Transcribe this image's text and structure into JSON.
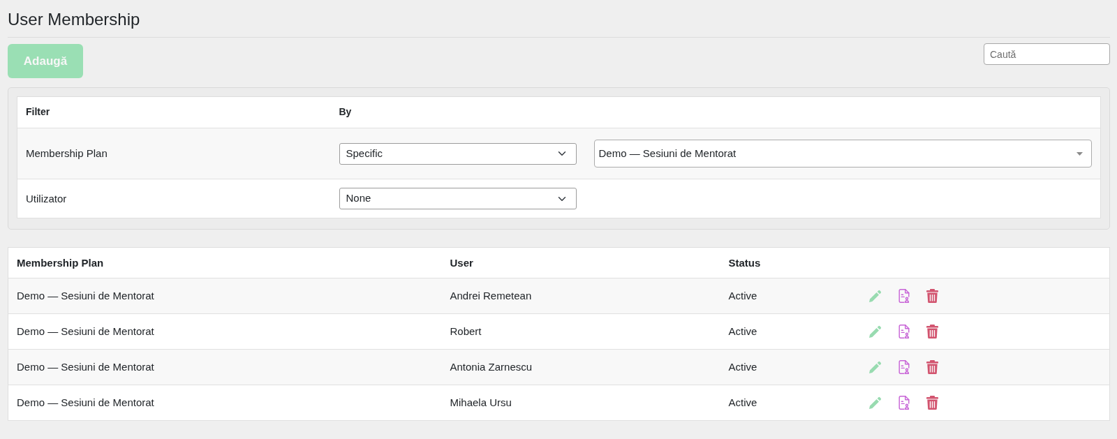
{
  "page": {
    "title": "User Membership"
  },
  "toolbar": {
    "add_button": {
      "label": "Adaugă",
      "disabled": true
    },
    "search": {
      "placeholder": "Caută"
    }
  },
  "filter": {
    "columns": [
      "Filter",
      "By"
    ],
    "rows": [
      {
        "label": "Membership Plan",
        "mode": "Specific",
        "value": "Demo — Sesiuni de Mentorat"
      },
      {
        "label": "Utilizator",
        "mode": "None"
      }
    ]
  },
  "table": {
    "columns": [
      "Membership Plan",
      "User",
      "Status"
    ],
    "rows": [
      {
        "cells": [
          "Demo — Sesiuni de Mentorat",
          "Andrei Remetean",
          "Active"
        ]
      },
      {
        "cells": [
          "Demo — Sesiuni de Mentorat",
          "Robert",
          "Active"
        ]
      },
      {
        "cells": [
          "Demo — Sesiuni de Mentorat",
          "Antonia Zarnescu",
          "Active"
        ]
      },
      {
        "cells": [
          "Demo — Sesiuni de Mentorat",
          "Mihaela Ursu",
          "Active"
        ]
      }
    ]
  }
}
